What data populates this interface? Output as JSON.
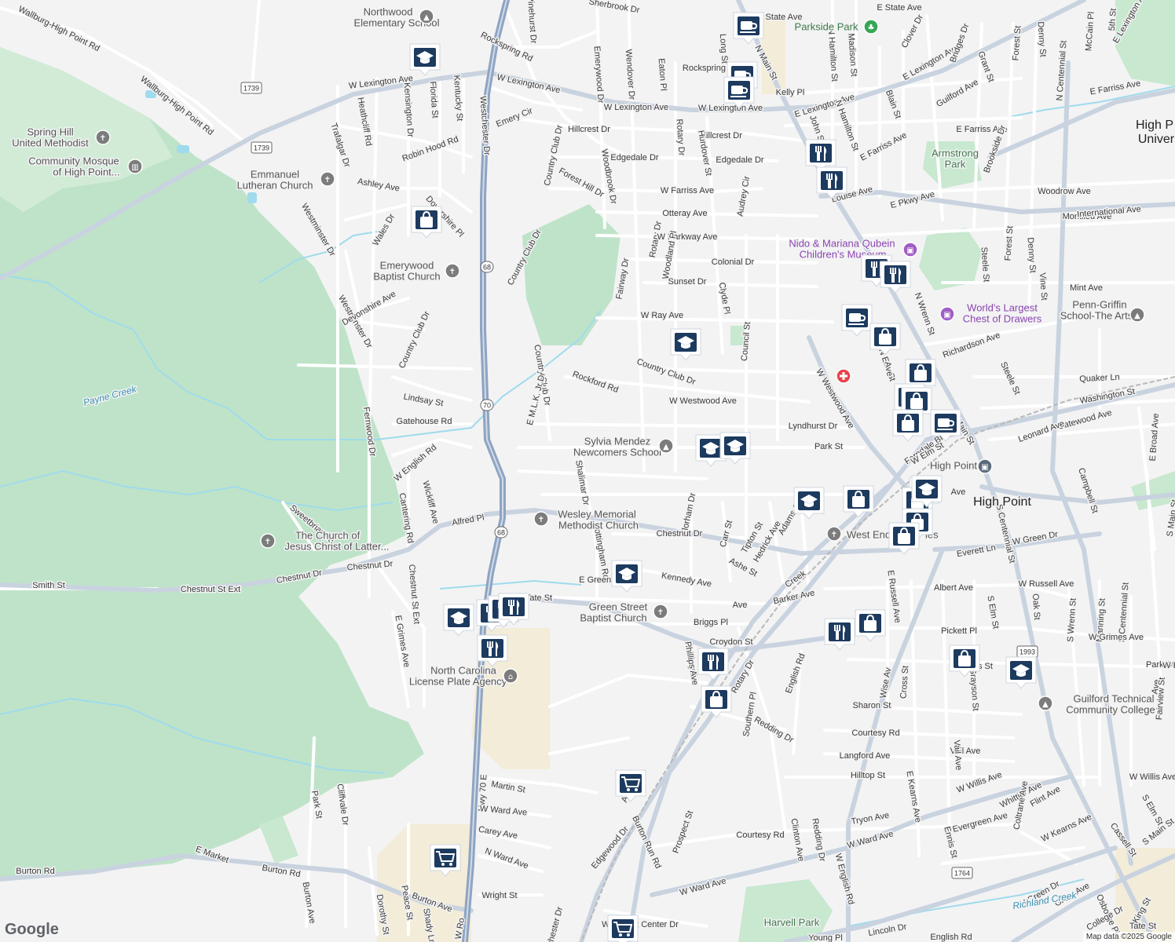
{
  "map": {
    "attribution": "Map data ©2025 Google",
    "logo": "Google",
    "colors": {
      "land": "#f3f3f4",
      "park": "#d7ecd9",
      "forest": "#bfe3c9",
      "road_minor": "#ffffff",
      "road_major": "#c9d3df",
      "highway": "#8ea4c2",
      "water": "#9fdbec",
      "rail": "#b8b8b8",
      "sand": "#f3ecd8",
      "pin": "#1d3a5f",
      "hospital": "#e8434a"
    },
    "streets": [
      {
        "text": "Wallburg-High Point Rd"
      },
      {
        "text": "Wallburg-High Point Rd"
      },
      {
        "text": "W Lexington Ave"
      },
      {
        "text": "W Lexington Ave"
      },
      {
        "text": "W Lexington Ave"
      },
      {
        "text": "W Lexington Ave"
      },
      {
        "text": "E Lexington Ave"
      },
      {
        "text": "E Lexington Ave"
      },
      {
        "text": "E Lexington Ave"
      },
      {
        "text": "Westchester Dr"
      },
      {
        "text": "Hwy 70 E"
      },
      {
        "text": "Rockspring Rd"
      },
      {
        "text": "Rockspring Rd"
      },
      {
        "text": "Pinehurst Dr"
      },
      {
        "text": "Sherbrook Dr"
      },
      {
        "text": "Emerywood Dr"
      },
      {
        "text": "Wendover Dr"
      },
      {
        "text": "Eaton Pl"
      },
      {
        "text": "Rotary Dr"
      },
      {
        "text": "Rotary Dr"
      },
      {
        "text": "Rotary Dr"
      },
      {
        "text": "Long St"
      },
      {
        "text": "N Main St"
      },
      {
        "text": "N Main St"
      },
      {
        "text": "Kelly Pl"
      },
      {
        "text": "N Hamilton St"
      },
      {
        "text": "N Hamilton St"
      },
      {
        "text": "Madison St"
      },
      {
        "text": "Clover Dr"
      },
      {
        "text": "Bridges Dr"
      },
      {
        "text": "Forest St"
      },
      {
        "text": "Forest St"
      },
      {
        "text": "Denny St"
      },
      {
        "text": "Denny St"
      },
      {
        "text": "McCain Pl"
      },
      {
        "text": "5th St"
      },
      {
        "text": "E State Ave"
      },
      {
        "text": "State Ave"
      },
      {
        "text": "Grant St"
      },
      {
        "text": "Guilford Ave"
      },
      {
        "text": "Blain St"
      },
      {
        "text": "John St"
      },
      {
        "text": "E Farriss Ave"
      },
      {
        "text": "E Farriss Ave"
      },
      {
        "text": "E Farriss Ave"
      },
      {
        "text": "W Farriss Ave"
      },
      {
        "text": "Emery Cir"
      },
      {
        "text": "Hillcrest Dr"
      },
      {
        "text": "Hillcrest Dr"
      },
      {
        "text": "Edgedale Dr"
      },
      {
        "text": "Edgedale Dr"
      },
      {
        "text": "Hurdover St"
      },
      {
        "text": "Country Club Dr"
      },
      {
        "text": "Country Club Dr"
      },
      {
        "text": "Country Club Dr"
      },
      {
        "text": "Country Club Dr"
      },
      {
        "text": "Robin Hood Rd"
      },
      {
        "text": "Trafalgar Dr"
      },
      {
        "text": "Heathcliff Rd"
      },
      {
        "text": "Kensington Dr"
      },
      {
        "text": "Florida St"
      },
      {
        "text": "Kentucky St"
      },
      {
        "text": "Ashley Ave"
      },
      {
        "text": "Forest Hill Dr"
      },
      {
        "text": "Woodbrook Dr"
      },
      {
        "text": "Audrey Cir"
      },
      {
        "text": "Louise Ave"
      },
      {
        "text": "E Pkwy Ave"
      },
      {
        "text": "Woodrow Ave"
      },
      {
        "text": "Otteray Ave"
      },
      {
        "text": "Montlieu Ave"
      },
      {
        "text": "International Ave"
      },
      {
        "text": "W Parkway Ave"
      },
      {
        "text": "Colonial Dr"
      },
      {
        "text": "Westminster Dr"
      },
      {
        "text": "Westminster Dr"
      },
      {
        "text": "Wales Dr"
      },
      {
        "text": "Dovershire Pl"
      },
      {
        "text": "N Centennial St"
      },
      {
        "text": "Brookside Dr"
      },
      {
        "text": "Steele St"
      },
      {
        "text": "Steele St"
      },
      {
        "text": "Sunset Dr"
      },
      {
        "text": "Woodland Pl"
      },
      {
        "text": "Fairway Dr"
      },
      {
        "text": "Clyde Pl"
      },
      {
        "text": "Vine St"
      },
      {
        "text": "Mint Ave"
      },
      {
        "text": "N Wrenn St"
      },
      {
        "text": "Devonshire Ave"
      },
      {
        "text": "W Ray Ave"
      },
      {
        "text": "Council St"
      },
      {
        "text": "N Elm St"
      },
      {
        "text": "Richardson Ave"
      },
      {
        "text": "Country Club Dr"
      },
      {
        "text": "Quaker Ln"
      },
      {
        "text": "Washington St"
      },
      {
        "text": "E M.L.K. Jr Dr"
      },
      {
        "text": "Rockford Rd"
      },
      {
        "text": "W Westwood Ave"
      },
      {
        "text": "W Westwood Ave"
      },
      {
        "text": "Lindsay St"
      },
      {
        "text": "Fernwood Dr"
      },
      {
        "text": "Gatehouse Rd"
      },
      {
        "text": "Lyndhurst Dr"
      },
      {
        "text": "Gatewood Ave"
      },
      {
        "text": "Leonard Ave"
      },
      {
        "text": "E Broad Ave"
      },
      {
        "text": "Park St"
      },
      {
        "text": "Ferndale Blvd"
      },
      {
        "text": "W English Rd"
      },
      {
        "text": "Wickliff Ave"
      },
      {
        "text": "Cantering Rd"
      },
      {
        "text": "Sweetbriar Rd"
      },
      {
        "text": "Shalimar Dr"
      },
      {
        "text": "Florham Dr"
      },
      {
        "text": "Carr St"
      },
      {
        "text": "Tipton St"
      },
      {
        "text": "Adams St"
      },
      {
        "text": "Alfred Pl"
      },
      {
        "text": "Chestnut Dr"
      },
      {
        "text": "Chestnut Dr"
      },
      {
        "text": "Chestnut Dr"
      },
      {
        "text": "Hedrick Ave"
      },
      {
        "text": "Campbell St"
      },
      {
        "text": "S Centennial St"
      },
      {
        "text": "S Main St"
      },
      {
        "text": "Smith St"
      },
      {
        "text": "Chestnut St Ext"
      },
      {
        "text": "Chestnut St Ext"
      },
      {
        "text": "Nottingham Rd"
      },
      {
        "text": "Ashe St"
      },
      {
        "text": "Kennedy Ave"
      },
      {
        "text": "Everett Ln"
      },
      {
        "text": "W Green Dr"
      },
      {
        "text": "E Green Dr"
      },
      {
        "text": "Creek"
      },
      {
        "text": "Albert Ave"
      },
      {
        "text": "W Russell Ave"
      },
      {
        "text": "E Russell Ave"
      },
      {
        "text": "Oak St"
      },
      {
        "text": "S Wrenn St"
      },
      {
        "text": "Manning St"
      },
      {
        "text": "S Centennial St"
      },
      {
        "text": "Tate St"
      },
      {
        "text": "Tate St"
      },
      {
        "text": "Ave"
      },
      {
        "text": "Barker Ave"
      },
      {
        "text": "Briggs Pl"
      },
      {
        "text": "Pickett Pl"
      },
      {
        "text": "W Grimes Ave"
      },
      {
        "text": "E Grimes Ave"
      },
      {
        "text": "Croydon St"
      },
      {
        "text": "Phillips Ave"
      },
      {
        "text": "Rotary Dr"
      },
      {
        "text": "English Rd"
      },
      {
        "text": "Millis St"
      },
      {
        "text": "Ave"
      },
      {
        "text": "Park St"
      },
      {
        "text": "Wise Av"
      },
      {
        "text": "Cross St"
      },
      {
        "text": "Grayson St"
      },
      {
        "text": "Fairview St"
      },
      {
        "text": "Sharon St"
      },
      {
        "text": "Redding Dr"
      },
      {
        "text": "Southern Pl"
      },
      {
        "text": "Courtesy Rd"
      },
      {
        "text": "Langford Ave"
      },
      {
        "text": "Vail Ave"
      },
      {
        "text": "Vail Ave"
      },
      {
        "text": "Hilltop St"
      },
      {
        "text": "Tryon Ave"
      },
      {
        "text": "W Willis Ave"
      },
      {
        "text": "W Willis Ave"
      },
      {
        "text": "E Kearns Ave"
      },
      {
        "text": "Martin St"
      },
      {
        "text": "Whittier Ave"
      },
      {
        "text": "W Ward Ave"
      },
      {
        "text": "W Ward Ave"
      },
      {
        "text": "W Ward Ave"
      },
      {
        "text": "Carey Ave"
      },
      {
        "text": "N Ward Ave"
      },
      {
        "text": "Evergreen Ave"
      },
      {
        "text": "Flint Ave"
      },
      {
        "text": "W Kearns Ave"
      },
      {
        "text": "Coltrane Ave"
      },
      {
        "text": "S Elm St"
      },
      {
        "text": "S Elm St"
      },
      {
        "text": "Park St"
      },
      {
        "text": "Cliffvale Dr"
      },
      {
        "text": "Burton Run Rd"
      },
      {
        "text": "Prospect St"
      },
      {
        "text": "Courtesy Rd"
      },
      {
        "text": "Clinton Ave"
      },
      {
        "text": "Redding Dr"
      },
      {
        "text": "Ennis St"
      },
      {
        "text": "Cassell St"
      },
      {
        "text": "S Main St"
      },
      {
        "text": "E Market"
      },
      {
        "text": "Burton Rd"
      },
      {
        "text": "Burton Rd"
      },
      {
        "text": "Burton Ave"
      },
      {
        "text": "Burton Ave"
      },
      {
        "text": "Dorothy St"
      },
      {
        "text": "Peace St"
      },
      {
        "text": "Shady Ln"
      },
      {
        "text": "Wright St"
      },
      {
        "text": "Edgewood Dr"
      },
      {
        "text": "W English Rd"
      },
      {
        "text": "W Green Dr"
      },
      {
        "text": "Greer Ave"
      },
      {
        "text": "Osborne Pl"
      },
      {
        "text": "King St"
      },
      {
        "text": "College Dr"
      },
      {
        "text": "W Market Center Dr"
      },
      {
        "text": "Lincoln Dr"
      },
      {
        "text": "Young Pl"
      },
      {
        "text": "Ave"
      },
      {
        "text": "W Ro"
      },
      {
        "text": "chester Dr"
      },
      {
        "text": "English Rd"
      },
      {
        "text": "Ave"
      },
      {
        "text": "W Elm St"
      },
      {
        "text": "W Engl"
      },
      {
        "text": "Ave"
      },
      {
        "text": "Ave"
      }
    ],
    "places": [
      {
        "text": "Northwood",
        "icon": "school-icon"
      },
      {
        "text": "Elementary School",
        "icon": ""
      },
      {
        "text": "Spring Hill",
        "icon": "church-icon"
      },
      {
        "text": "United Methodist",
        "icon": ""
      },
      {
        "text": "Community Mosque",
        "icon": "mosque-icon"
      },
      {
        "text": "of High Point...",
        "icon": ""
      },
      {
        "text": "Emmanuel",
        "icon": "church-icon"
      },
      {
        "text": "Lutheran Church",
        "icon": ""
      },
      {
        "text": "Emerywood",
        "icon": "church-icon"
      },
      {
        "text": "Baptist Church",
        "icon": ""
      },
      {
        "text": "Sylvia Mendez",
        "icon": "school-icon"
      },
      {
        "text": "Newcomers School",
        "icon": ""
      },
      {
        "text": "Wesley Memorial",
        "icon": "church-icon"
      },
      {
        "text": "Methodist Church",
        "icon": ""
      },
      {
        "text": "The Church of",
        "icon": "church-icon"
      },
      {
        "text": "Jesus Christ of Latter...",
        "icon": ""
      },
      {
        "text": "Green Street",
        "icon": "church-icon"
      },
      {
        "text": "Baptist Church",
        "icon": ""
      },
      {
        "text": "North Carolina",
        "icon": "government-icon"
      },
      {
        "text": "License Plate Agency",
        "icon": ""
      },
      {
        "text": "West End",
        "icon": "church-icon"
      },
      {
        "text": "ies",
        "icon": ""
      },
      {
        "text": "Guilford Technical",
        "icon": "school-icon"
      },
      {
        "text": "Community College",
        "icon": ""
      },
      {
        "text": "Penn-Griffin",
        "icon": "school-icon"
      },
      {
        "text": "School-The Arts",
        "icon": ""
      },
      {
        "text": "High Point",
        "icon": "train-station-icon"
      }
    ],
    "parks": [
      {
        "text": "Parkside Park",
        "icon": "park-icon"
      },
      {
        "text": "Armstrong",
        "icon": ""
      },
      {
        "text": "Park",
        "icon": ""
      },
      {
        "text": "Harvell Park",
        "icon": ""
      }
    ],
    "museums": [
      {
        "text": "Nido & Mariana Qubein",
        "icon": "museum-icon"
      },
      {
        "text": "Children's Museum",
        "icon": ""
      },
      {
        "text": "World's Largest",
        "icon": "museum-icon"
      },
      {
        "text": "Chest of Drawers",
        "icon": ""
      }
    ],
    "water": [
      "Payne Creek",
      "Richland Creek"
    ],
    "cities": [
      "High Point",
      "High P",
      "Univer"
    ],
    "shields": [
      "1739",
      "1739",
      "68",
      "70",
      "68",
      "1764",
      "1993"
    ],
    "pins": [
      {
        "type": "school",
        "icon": "school-icon"
      },
      {
        "type": "coffee",
        "icon": "coffee-icon"
      },
      {
        "type": "coffee",
        "icon": "coffee-icon"
      },
      {
        "type": "coffee",
        "icon": "coffee-icon"
      },
      {
        "type": "restaurant",
        "icon": "restaurant-icon"
      },
      {
        "type": "restaurant",
        "icon": "restaurant-icon"
      },
      {
        "type": "shopping",
        "icon": "shopping-bag-icon"
      },
      {
        "type": "restaurant",
        "icon": "restaurant-icon"
      },
      {
        "type": "restaurant",
        "icon": "restaurant-icon"
      },
      {
        "type": "coffee",
        "icon": "coffee-icon"
      },
      {
        "type": "shopping",
        "icon": "shopping-bag-icon"
      },
      {
        "type": "school",
        "icon": "school-icon"
      },
      {
        "type": "shopping",
        "icon": "shopping-bag-icon"
      },
      {
        "type": "shopping",
        "icon": "shopping-bag-icon"
      },
      {
        "type": "shopping",
        "icon": "shopping-bag-icon"
      },
      {
        "type": "shopping",
        "icon": "shopping-bag-icon"
      },
      {
        "type": "coffee",
        "icon": "coffee-icon"
      },
      {
        "type": "school",
        "icon": "school-icon"
      },
      {
        "type": "school",
        "icon": "school-icon"
      },
      {
        "type": "school",
        "icon": "school-icon"
      },
      {
        "type": "shopping",
        "icon": "shopping-bag-icon"
      },
      {
        "type": "restaurant",
        "icon": "restaurant-icon"
      },
      {
        "type": "shopping",
        "icon": "shopping-bag-icon"
      },
      {
        "type": "shopping",
        "icon": "shopping-bag-icon"
      },
      {
        "type": "shopping",
        "icon": "shopping-bag-icon"
      },
      {
        "type": "school",
        "icon": "school-icon"
      },
      {
        "type": "school",
        "icon": "school-icon"
      },
      {
        "type": "restaurant",
        "icon": "restaurant-icon"
      },
      {
        "type": "restaurant",
        "icon": "restaurant-icon"
      },
      {
        "type": "restaurant",
        "icon": "restaurant-icon"
      },
      {
        "type": "restaurant",
        "icon": "restaurant-icon"
      },
      {
        "type": "restaurant",
        "icon": "restaurant-icon"
      },
      {
        "type": "shopping",
        "icon": "shopping-bag-icon"
      },
      {
        "type": "restaurant",
        "icon": "restaurant-icon"
      },
      {
        "type": "shopping",
        "icon": "shopping-bag-icon"
      },
      {
        "type": "shopping",
        "icon": "shopping-bag-icon"
      },
      {
        "type": "school",
        "icon": "school-icon"
      },
      {
        "type": "grocery",
        "icon": "shopping-cart-icon"
      },
      {
        "type": "grocery",
        "icon": "shopping-cart-icon"
      },
      {
        "type": "grocery",
        "icon": "shopping-cart-icon"
      },
      {
        "type": "school",
        "icon": "school-icon"
      }
    ],
    "hospital": {
      "icon": "hospital-icon"
    }
  }
}
